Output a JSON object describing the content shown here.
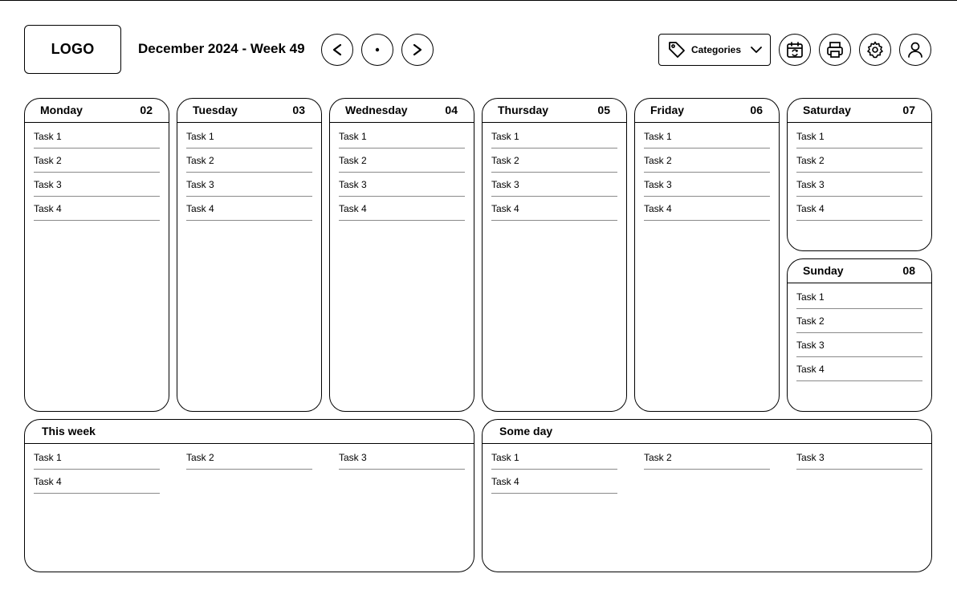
{
  "header": {
    "logo": "LOGO",
    "title": "December 2024 - Week 49",
    "prev_icon": "chevron-left-icon",
    "today_icon": "dot-icon",
    "next_icon": "chevron-right-icon",
    "categories_label": "Categories",
    "tag_icon": "tag-icon",
    "dropdown_icon": "chevron-down-icon",
    "sync_icon": "calendar-sync-icon",
    "print_icon": "printer-icon",
    "settings_icon": "gear-icon",
    "user_icon": "user-icon"
  },
  "days": [
    {
      "name": "Monday",
      "num": "02",
      "tasks": [
        "Task 1",
        "Task 2",
        "Task 3",
        "Task 4"
      ]
    },
    {
      "name": "Tuesday",
      "num": "03",
      "tasks": [
        "Task 1",
        "Task 2",
        "Task 3",
        "Task 4"
      ]
    },
    {
      "name": "Wednesday",
      "num": "04",
      "tasks": [
        "Task 1",
        "Task 2",
        "Task 3",
        "Task 4"
      ]
    },
    {
      "name": "Thursday",
      "num": "05",
      "tasks": [
        "Task 1",
        "Task 2",
        "Task 3",
        "Task 4"
      ]
    },
    {
      "name": "Friday",
      "num": "06",
      "tasks": [
        "Task 1",
        "Task 2",
        "Task 3",
        "Task 4"
      ]
    },
    {
      "name": "Saturday",
      "num": "07",
      "tasks": [
        "Task 1",
        "Task 2",
        "Task 3",
        "Task 4"
      ]
    },
    {
      "name": "Sunday",
      "num": "08",
      "tasks": [
        "Task 1",
        "Task 2",
        "Task 3",
        "Task 4"
      ]
    }
  ],
  "this_week": {
    "title": "This week",
    "tasks": [
      "Task 1",
      "Task 2",
      "Task 3",
      "Task 4"
    ]
  },
  "some_day": {
    "title": "Some day",
    "tasks": [
      "Task 1",
      "Task 2",
      "Task 3",
      "Task 4"
    ]
  }
}
